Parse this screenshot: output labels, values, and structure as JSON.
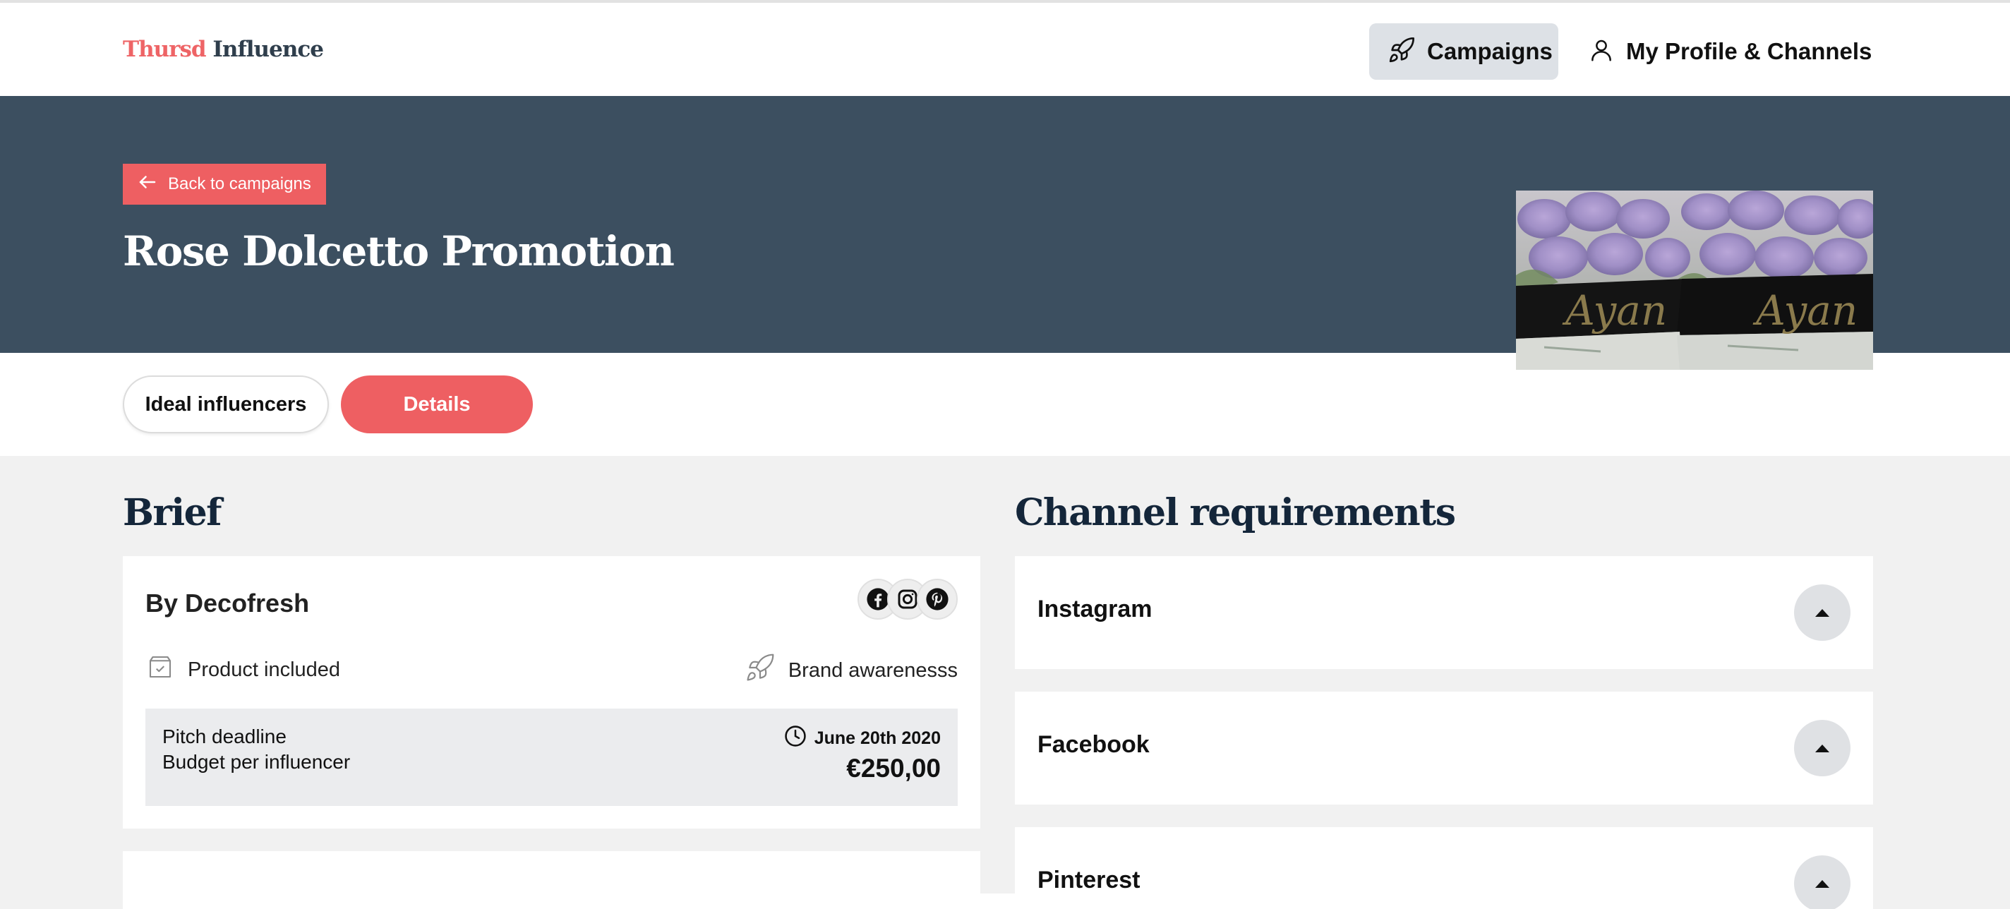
{
  "brand": {
    "logo_part1": "Thursd",
    "logo_part2": "Influence"
  },
  "nav": {
    "campaigns": "Campaigns",
    "profile": "My Profile & Channels"
  },
  "hero": {
    "back_label": "Back to campaigns",
    "title": "Rose Dolcetto Promotion",
    "image_text": "Ayan"
  },
  "tabs": {
    "ideal": "Ideal influencers",
    "details": "Details"
  },
  "brief": {
    "heading": "Brief",
    "by": "By Decofresh",
    "product_included": "Product included",
    "goal": "Brand awarenesss",
    "pitch_deadline_label": "Pitch deadline",
    "budget_label": "Budget per influencer",
    "pitch_deadline_value": "June 20th 2020",
    "budget_value": "€250,00"
  },
  "channels": {
    "heading": "Channel requirements",
    "items": [
      {
        "label": "Instagram"
      },
      {
        "label": "Facebook"
      },
      {
        "label": "Pinterest"
      }
    ]
  },
  "icons": {
    "nav_campaigns": "rocket-icon",
    "nav_profile": "user-icon",
    "back": "arrow-left-icon",
    "socials": [
      "facebook-icon",
      "instagram-icon",
      "pinterest-icon"
    ],
    "product": "box-check-icon",
    "goal": "rocket-icon",
    "deadline": "clock-icon",
    "channel_toggle": "caret-up-icon"
  },
  "colors": {
    "accent": "#ee5f62",
    "hero_bg": "#3c4f60",
    "heading": "#14263a",
    "page_bg": "#f1f1f1"
  }
}
